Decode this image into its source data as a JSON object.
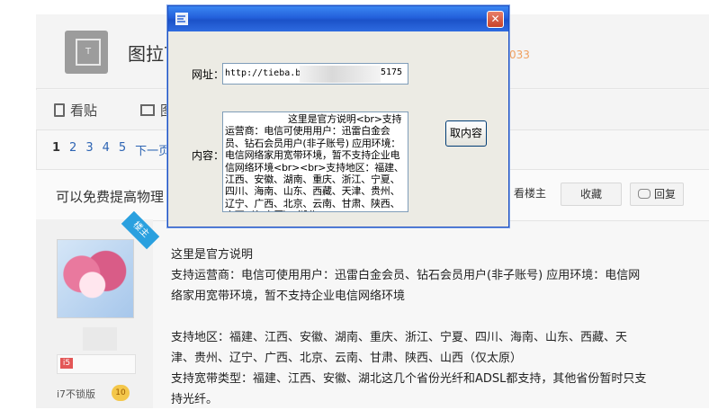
{
  "forum": {
    "name": "图拉丁",
    "stat_text": "033",
    "tabs": [
      {
        "label": "看贴",
        "icon": "document-icon"
      },
      {
        "label": "图",
        "icon": "image-icon"
      }
    ]
  },
  "pager": {
    "current": "1",
    "pages": [
      "2",
      "3",
      "4",
      "5"
    ],
    "next_label": "下一页"
  },
  "thread": {
    "title": "可以免费提高物理",
    "buttons": {
      "only_op": "看楼主",
      "favorite": "收藏",
      "reply": "回复"
    }
  },
  "author": {
    "badge": "楼主",
    "tag": "i7不锁版",
    "level": "10",
    "level_icon": "i5"
  },
  "post": {
    "line1": "这里是官方说明",
    "line2": "支持运营商：电信可使用用户：迅雷白金会员、钻石会员用户(非子账号) 应用环境：电信网",
    "line3": "络家用宽带环境，暂不支持企业电信网络环境",
    "line4": "支持地区：福建、江西、安徽、湖南、重庆、浙江、宁夏、四川、海南、山东、西藏、天",
    "line5": "津、贵州、辽宁、广西、北京、云南、甘肃、陕西、山西（仅太原）",
    "line6": "支持宽带类型：福建、江西、安徽、湖北这几个省份光纤和ADSL都支持，其他省份暂时只支",
    "line7": "持光纤。"
  },
  "dialog": {
    "close_symbol": "✕",
    "url_label": "网址：",
    "url_value": "http://tieba.b",
    "url_tail": "5175",
    "content_label": "内容：",
    "content_value": "这里是官方说明<br>支持运营商：电信可使用用户：迅雷白金会员、钻石会员用户(非子账号) 应用环境：电信网络家用宽带环境，暂不支持企业电信网络环境<br><br>支持地区：福建、江西、安徽、湖南、重庆、浙江、宁夏、四川、海南、山东、西藏、天津、贵州、辽宁、广西、北京、云南、甘肃、陕西、山西（仅太原）、湖北(",
    "fetch_button": "取内容"
  },
  "colors": {
    "titlebar": "#2360db",
    "dialog_bg": "#ecebe4",
    "link": "#2d64b3",
    "close_button": "#c94228"
  }
}
